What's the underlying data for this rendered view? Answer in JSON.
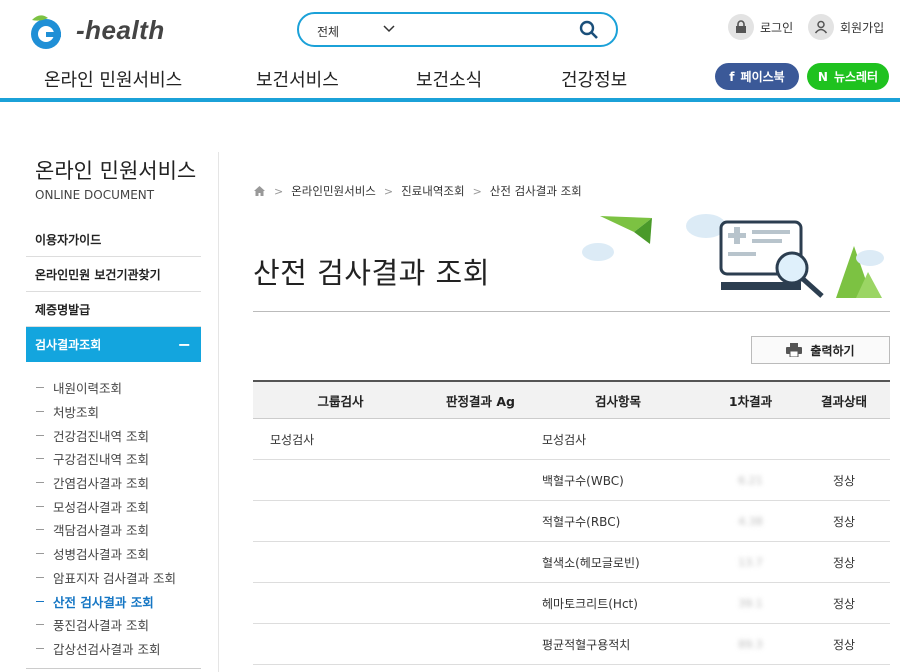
{
  "header": {
    "logo_text": "-health",
    "search": {
      "scope": "전체",
      "placeholder": ""
    },
    "login_label": "로그인",
    "join_label": "회원가입",
    "gnb": [
      "온라인 민원서비스",
      "보건서비스",
      "보건소식",
      "건강정보"
    ],
    "facebook_label": "페이스북",
    "newsletter_label": "뉴스레터"
  },
  "sidebar": {
    "title": "온라인 민원서비스",
    "subtitle": "ONLINE DOCUMENT",
    "items": [
      {
        "label": "이용자가이드"
      },
      {
        "label": "온라인민원 보건기관찾기"
      },
      {
        "label": "제증명발급"
      },
      {
        "label": "검사결과조회"
      }
    ],
    "toggle_symbol": "−",
    "sub_items": [
      "내원이력조회",
      "처방조회",
      "건강검진내역 조회",
      "구강검진내역 조회",
      "간염검사결과 조회",
      "모성검사결과 조회",
      "객담검사결과 조회",
      "성병검사결과 조회",
      "암표지자 검사결과 조회",
      "산전 검사결과 조회",
      "풍진검사결과 조회",
      "갑상선검사결과 조회"
    ],
    "current_sub": "산전 검사결과 조회"
  },
  "main": {
    "breadcrumb": [
      "온라인민원서비스",
      "진료내역조회",
      "산전 검사결과 조회"
    ],
    "title": "산전 검사결과 조회",
    "print_label": "출력하기",
    "table": {
      "headers": [
        "그룹검사",
        "판정결과 Ag",
        "검사항목",
        "1차결과",
        "결과상태"
      ],
      "rows": [
        {
          "group": "모성검사",
          "ag": "",
          "item": "모성검사",
          "result": "",
          "status": ""
        },
        {
          "group": "",
          "ag": "",
          "item": "백혈구수(WBC)",
          "result": "6.21",
          "status": "정상"
        },
        {
          "group": "",
          "ag": "",
          "item": "적혈구수(RBC)",
          "result": "4.38",
          "status": "정상"
        },
        {
          "group": "",
          "ag": "",
          "item": "혈색소(헤모글로빈)",
          "result": "13.7",
          "status": "정상"
        },
        {
          "group": "",
          "ag": "",
          "item": "헤마토크리트(Hct)",
          "result": "39.1",
          "status": "정상"
        },
        {
          "group": "",
          "ag": "",
          "item": "평균적혈구용적치",
          "result": "89.3",
          "status": "정상"
        }
      ]
    }
  },
  "colors": {
    "accent": "#1ba1d8",
    "facebook": "#3b5998",
    "newsletter": "#1fc21f",
    "active_menu": "#13a5de",
    "current_sub": "#1576c4"
  }
}
